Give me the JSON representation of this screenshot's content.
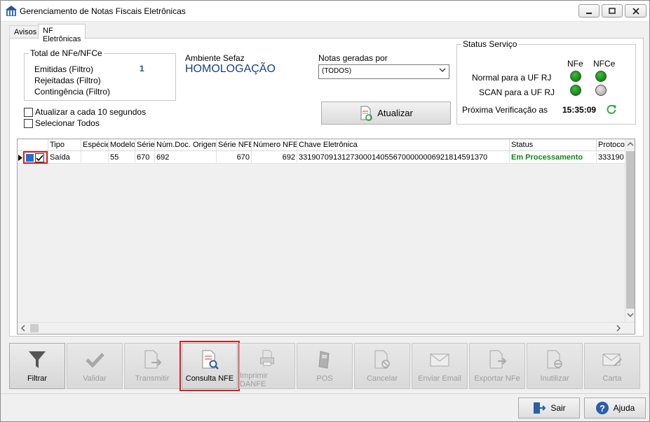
{
  "window": {
    "title": "Gerenciamento de Notas Fiscais Eletrônicas"
  },
  "tabs": [
    {
      "label": "Avisos"
    },
    {
      "label": "NF Eletrônicas"
    }
  ],
  "totals": {
    "group_title": "Total de NFe/NFCe",
    "emitidas_label": "Emitidas (Filtro)",
    "emitidas_value": "1",
    "rejeitadas_label": "Rejeitadas (Filtro)",
    "contingencia_label": "Contingência (Filtro)"
  },
  "ambiente": {
    "label": "Ambiente Sefaz",
    "value": "HOMOLOGAÇÃO"
  },
  "notas_geradas": {
    "label": "Notas geradas por",
    "selected": "(TODOS)"
  },
  "options": {
    "auto_refresh_label": "Atualizar a cada 10 segundos",
    "select_all_label": "Selecionar Todos"
  },
  "atualizar_button": "Atualizar",
  "status_servico": {
    "group_title": "Status Serviço",
    "col_nfe": "NFe",
    "col_nfce": "NFCe",
    "normal_label": "Normal para a UF RJ",
    "scan_label": "SCAN para a UF RJ",
    "proxima_label": "Próxima Verificação as",
    "proxima_time": "15:35:09"
  },
  "grid": {
    "columns": [
      "Tipo",
      "Espécie",
      "Modelo",
      "Série",
      "Núm.Doc. Origem",
      "Série NFE",
      "Número NFE",
      "Chave Eletrônica",
      "Status",
      "Protoco"
    ],
    "rows": [
      {
        "tipo": "Saída",
        "especie": "",
        "modelo": "55",
        "serie": "670",
        "num_doc_origem": "692",
        "serie_nfe": "670",
        "numero_nfe": "692",
        "chave": "33190709131273000140556700000006921814591370",
        "status": "Em Processamento",
        "protocolo": "333190"
      }
    ]
  },
  "toolbar": [
    {
      "label": "Filtrar",
      "icon": "filter-icon",
      "enabled": true
    },
    {
      "label": "Validar",
      "icon": "check-icon",
      "enabled": false
    },
    {
      "label": "Transmitir",
      "icon": "transmit-icon",
      "enabled": false
    },
    {
      "label": "Consulta NFE",
      "icon": "document-search-icon",
      "enabled": true
    },
    {
      "label": "Imprimir DANFE",
      "icon": "printer-icon",
      "enabled": false
    },
    {
      "label": "POS",
      "icon": "pos-terminal-icon",
      "enabled": false
    },
    {
      "label": "Cancelar",
      "icon": "cancel-document-icon",
      "enabled": false
    },
    {
      "label": "Enviar Email",
      "icon": "email-icon",
      "enabled": false
    },
    {
      "label": "Exportar NFe",
      "icon": "export-icon",
      "enabled": false
    },
    {
      "label": "Inutilizar",
      "icon": "void-document-icon",
      "enabled": false
    },
    {
      "label": "Carta",
      "icon": "letter-icon",
      "enabled": false
    }
  ],
  "footer": {
    "sair": "Sair",
    "ajuda": "Ajuda"
  },
  "colors": {
    "status_green": "#0b8a16",
    "led_on": "#0a8a0a",
    "highlight_red": "#d11f1f"
  }
}
